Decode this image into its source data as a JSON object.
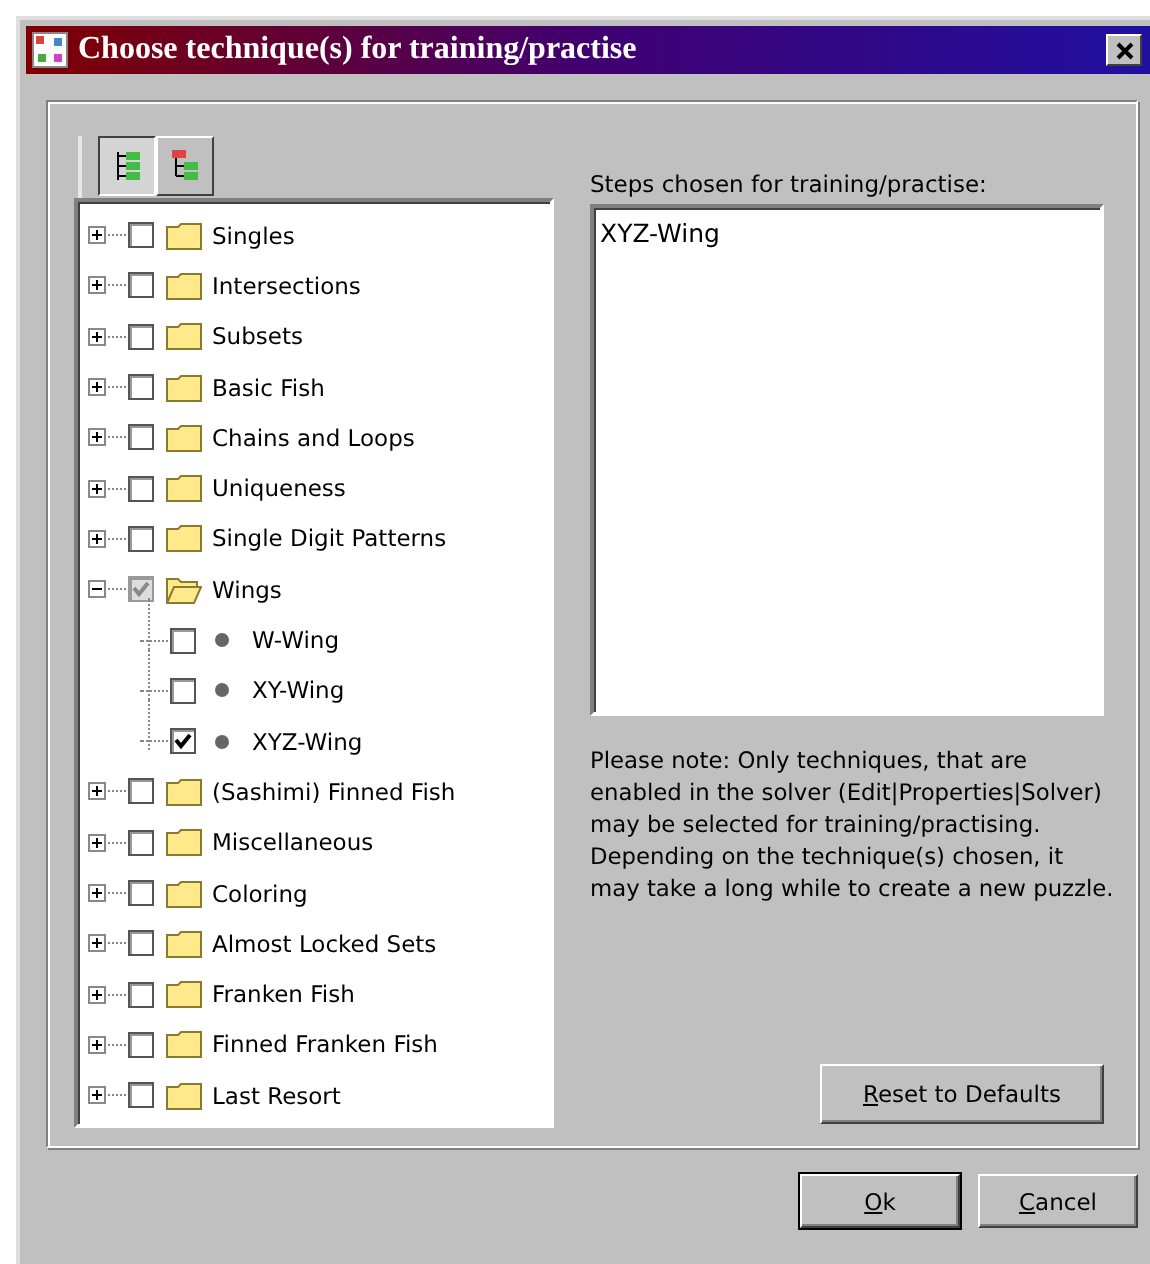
{
  "window": {
    "title": "Choose technique(s) for training/practise"
  },
  "toolbar": [
    {
      "selected": true
    },
    {
      "selected": false
    }
  ],
  "tree": [
    {
      "label": "Singles",
      "checked": false,
      "mixed": false,
      "expanded": false
    },
    {
      "label": "Intersections",
      "checked": false,
      "mixed": false,
      "expanded": false
    },
    {
      "label": "Subsets",
      "checked": false,
      "mixed": false,
      "expanded": false
    },
    {
      "label": "Basic Fish",
      "checked": false,
      "mixed": false,
      "expanded": false
    },
    {
      "label": "Chains and Loops",
      "checked": false,
      "mixed": false,
      "expanded": false
    },
    {
      "label": "Uniqueness",
      "checked": false,
      "mixed": false,
      "expanded": false
    },
    {
      "label": "Single Digit Patterns",
      "checked": false,
      "mixed": false,
      "expanded": false
    },
    {
      "label": "Wings",
      "checked": true,
      "mixed": true,
      "expanded": true,
      "children": [
        {
          "label": "W-Wing",
          "checked": false
        },
        {
          "label": "XY-Wing",
          "checked": false
        },
        {
          "label": "XYZ-Wing",
          "checked": true
        }
      ]
    },
    {
      "label": "(Sashimi) Finned Fish",
      "checked": false,
      "mixed": false,
      "expanded": false
    },
    {
      "label": "Miscellaneous",
      "checked": false,
      "mixed": false,
      "expanded": false
    },
    {
      "label": "Coloring",
      "checked": false,
      "mixed": false,
      "expanded": false
    },
    {
      "label": "Almost Locked Sets",
      "checked": false,
      "mixed": false,
      "expanded": false
    },
    {
      "label": "Franken Fish",
      "checked": false,
      "mixed": false,
      "expanded": false
    },
    {
      "label": "Finned Franken Fish",
      "checked": false,
      "mixed": false,
      "expanded": false
    },
    {
      "label": "Last Resort",
      "checked": false,
      "mixed": false,
      "expanded": false
    }
  ],
  "steps_label": "Steps chosen for training/practise:",
  "steps_list": [
    "XYZ-Wing"
  ],
  "note": "Please note: Only techniques, that are enabled in the solver (Edit|Properties|Solver) may be selected for training/practising. Depending on the technique(s) chosen, it may take a long while to create a new puzzle.",
  "reset_button": {
    "accel": "R",
    "rest": "eset to Defaults"
  },
  "buttons": [
    {
      "accel": "O",
      "rest": "k"
    },
    {
      "accel": "C",
      "rest": "ancel"
    }
  ]
}
